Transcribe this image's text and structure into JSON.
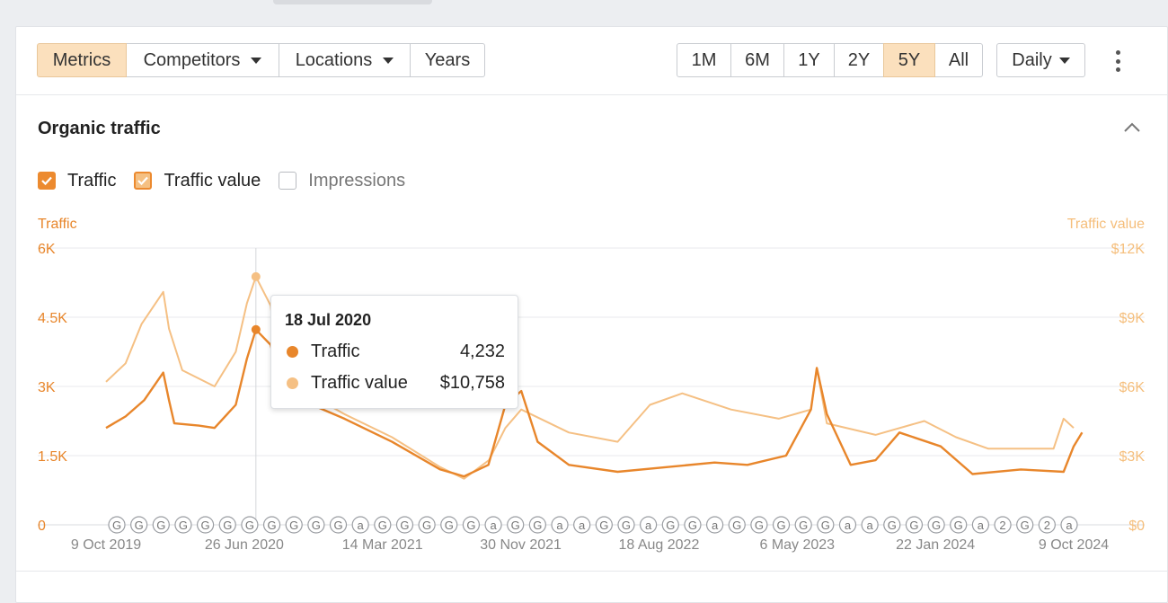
{
  "toolbar": {
    "left_group": [
      {
        "label": "Metrics",
        "active": true,
        "dropdown": false
      },
      {
        "label": "Competitors",
        "active": false,
        "dropdown": true
      },
      {
        "label": "Locations",
        "active": false,
        "dropdown": true
      },
      {
        "label": "Years",
        "active": false,
        "dropdown": false
      }
    ],
    "range_group": [
      {
        "label": "1M",
        "active": false
      },
      {
        "label": "6M",
        "active": false
      },
      {
        "label": "1Y",
        "active": false
      },
      {
        "label": "2Y",
        "active": false
      },
      {
        "label": "5Y",
        "active": true
      },
      {
        "label": "All",
        "active": false
      }
    ],
    "interval": "Daily",
    "more_icon": "kebab-vertical-icon"
  },
  "section": {
    "title": "Organic traffic",
    "collapse_icon": "chevron-up-icon"
  },
  "checkboxes": [
    {
      "label": "Traffic",
      "checked": true
    },
    {
      "label": "Traffic value",
      "checked": true
    },
    {
      "label": "Impressions",
      "checked": false
    }
  ],
  "colors": {
    "traffic": "#e8862b",
    "traffic_value": "#f5c084",
    "active_button": "#fbe0bd",
    "grid": "#e8eaed"
  },
  "tooltip": {
    "date": "18 Jul 2020",
    "rows": [
      {
        "name": "Traffic",
        "value": "4,232"
      },
      {
        "name": "Traffic value",
        "value": "$10,758"
      }
    ]
  },
  "chart_data": {
    "type": "line",
    "left_axis_label": "Traffic",
    "right_axis_label": "Traffic value",
    "left_ticks": [
      "0",
      "1.5K",
      "3K",
      "4.5K",
      "6K"
    ],
    "right_ticks": [
      "$0",
      "$3K",
      "$6K",
      "$9K",
      "$12K"
    ],
    "left_ylim": [
      0,
      6000
    ],
    "right_ylim": [
      0,
      12000
    ],
    "x_ticks": [
      "9 Oct 2019",
      "26 Jun 2020",
      "14 Mar 2021",
      "30 Nov 2021",
      "18 Aug 2022",
      "6 May 2023",
      "22 Jan 2024",
      "9 Oct 2024"
    ],
    "grid": true,
    "hover_x": "18 Jul 2020",
    "series": [
      {
        "name": "Traffic",
        "axis": "left",
        "points": [
          [
            "9 Oct 2019",
            2100
          ],
          [
            "15 Nov 2019",
            2350
          ],
          [
            "20 Dec 2019",
            2700
          ],
          [
            "25 Jan 2020",
            3300
          ],
          [
            "5 Feb 2020",
            2700
          ],
          [
            "15 Feb 2020",
            2200
          ],
          [
            "1 Apr 2020",
            2150
          ],
          [
            "1 May 2020",
            2100
          ],
          [
            "10 Jun 2020",
            2600
          ],
          [
            "1 Jul 2020",
            3600
          ],
          [
            "18 Jul 2020",
            4232
          ],
          [
            "15 Aug 2020",
            3900
          ],
          [
            "1 Sep 2020",
            3000
          ],
          [
            "1 Nov 2020",
            2600
          ],
          [
            "1 Jan 2021",
            2300
          ],
          [
            "1 Apr 2021",
            1800
          ],
          [
            "1 Jul 2021",
            1200
          ],
          [
            "15 Aug 2021",
            1050
          ],
          [
            "30 Sep 2021",
            1300
          ],
          [
            "1 Nov 2021",
            2600
          ],
          [
            "1 Dec 2021",
            2900
          ],
          [
            "1 Jan 2022",
            1800
          ],
          [
            "1 Mar 2022",
            1300
          ],
          [
            "1 Jun 2022",
            1150
          ],
          [
            "1 Sep 2022",
            1250
          ],
          [
            "1 Dec 2022",
            1350
          ],
          [
            "1 Feb 2023",
            1300
          ],
          [
            "15 Apr 2023",
            1500
          ],
          [
            "1 Jun 2023",
            2500
          ],
          [
            "12 Jun 2023",
            3400
          ],
          [
            "1 Jul 2023",
            2400
          ],
          [
            "15 Aug 2023",
            1300
          ],
          [
            "1 Oct 2023",
            1400
          ],
          [
            "15 Nov 2023",
            2000
          ],
          [
            "1 Feb 2024",
            1700
          ],
          [
            "1 Apr 2024",
            1100
          ],
          [
            "1 Jul 2024",
            1200
          ],
          [
            "20 Sep 2024",
            1150
          ],
          [
            "9 Oct 2024",
            1700
          ],
          [
            "25 Oct 2024",
            2000
          ]
        ]
      },
      {
        "name": "Traffic value",
        "axis": "right",
        "points": [
          [
            "9 Oct 2019",
            6200
          ],
          [
            "15 Nov 2019",
            7000
          ],
          [
            "15 Dec 2019",
            8700
          ],
          [
            "25 Jan 2020",
            10100
          ],
          [
            "5 Feb 2020",
            8500
          ],
          [
            "1 Mar 2020",
            6700
          ],
          [
            "1 May 2020",
            6000
          ],
          [
            "10 Jun 2020",
            7500
          ],
          [
            "1 Jul 2020",
            9600
          ],
          [
            "18 Jul 2020",
            10758
          ],
          [
            "15 Aug 2020",
            9500
          ],
          [
            "1 Sep 2020",
            6200
          ],
          [
            "1 Nov 2020",
            5600
          ],
          [
            "1 Jan 2021",
            4800
          ],
          [
            "1 Apr 2021",
            3800
          ],
          [
            "1 Jul 2021",
            2500
          ],
          [
            "15 Aug 2021",
            2000
          ],
          [
            "1 Oct 2021",
            2800
          ],
          [
            "1 Nov 2021",
            4200
          ],
          [
            "1 Dec 2021",
            5000
          ],
          [
            "1 Mar 2022",
            4000
          ],
          [
            "1 Jun 2022",
            3600
          ],
          [
            "1 Aug 2022",
            5200
          ],
          [
            "1 Oct 2022",
            5700
          ],
          [
            "1 Jan 2023",
            5000
          ],
          [
            "1 Apr 2023",
            4600
          ],
          [
            "1 Jun 2023",
            5000
          ],
          [
            "12 Jun 2023",
            6800
          ],
          [
            "1 Jul 2023",
            4400
          ],
          [
            "1 Oct 2023",
            3900
          ],
          [
            "1 Jan 2024",
            4500
          ],
          [
            "1 Mar 2024",
            3800
          ],
          [
            "1 May 2024",
            3300
          ],
          [
            "1 Sep 2024",
            3300
          ],
          [
            "20 Sep 2024",
            4600
          ],
          [
            "9 Oct 2024",
            4200
          ]
        ]
      }
    ],
    "annotation_markers": [
      "G",
      "G",
      "G",
      "G",
      "G",
      "G",
      "G",
      "G",
      "G",
      "G",
      "G",
      "a",
      "G",
      "G",
      "G",
      "G",
      "G",
      "a",
      "G",
      "G",
      "a",
      "a",
      "G",
      "G",
      "a",
      "G",
      "G",
      "a",
      "G",
      "G",
      "G",
      "G",
      "G",
      "a",
      "a",
      "G",
      "G",
      "G",
      "G",
      "a",
      "2",
      "G",
      "2",
      "a"
    ]
  }
}
